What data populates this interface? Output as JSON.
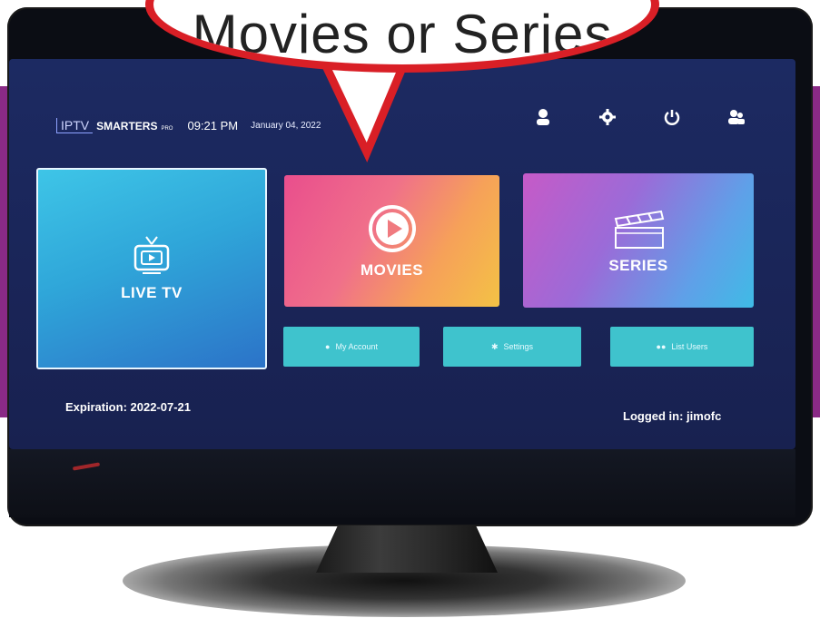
{
  "callout": {
    "text": "Movies or Series"
  },
  "header": {
    "logo_iptv": "IPTV",
    "logo_smarters": "SMARTERS",
    "logo_pro": "PRO",
    "time": "09:21 PM",
    "date": "January 04, 2022",
    "icons": [
      "account-icon",
      "settings-icon",
      "power-icon",
      "switch-user-icon"
    ]
  },
  "tiles": {
    "live_tv": "LIVE TV",
    "movies": "MOVIES",
    "series": "SERIES"
  },
  "buttons": {
    "account": "My Account",
    "settings": "Settings",
    "list_users": "List Users"
  },
  "footer": {
    "expiration": "Expiration: 2022-07-21",
    "logged_in": "Logged in: jimofc"
  },
  "colors": {
    "callout_border": "#d91f26",
    "screen_bg": "#1c2a62",
    "button_bg": "#3fc3cd",
    "live_tile": "#2fa6d9",
    "movies_tile": "#f0708a",
    "series_tile": "#9b6bd8"
  }
}
